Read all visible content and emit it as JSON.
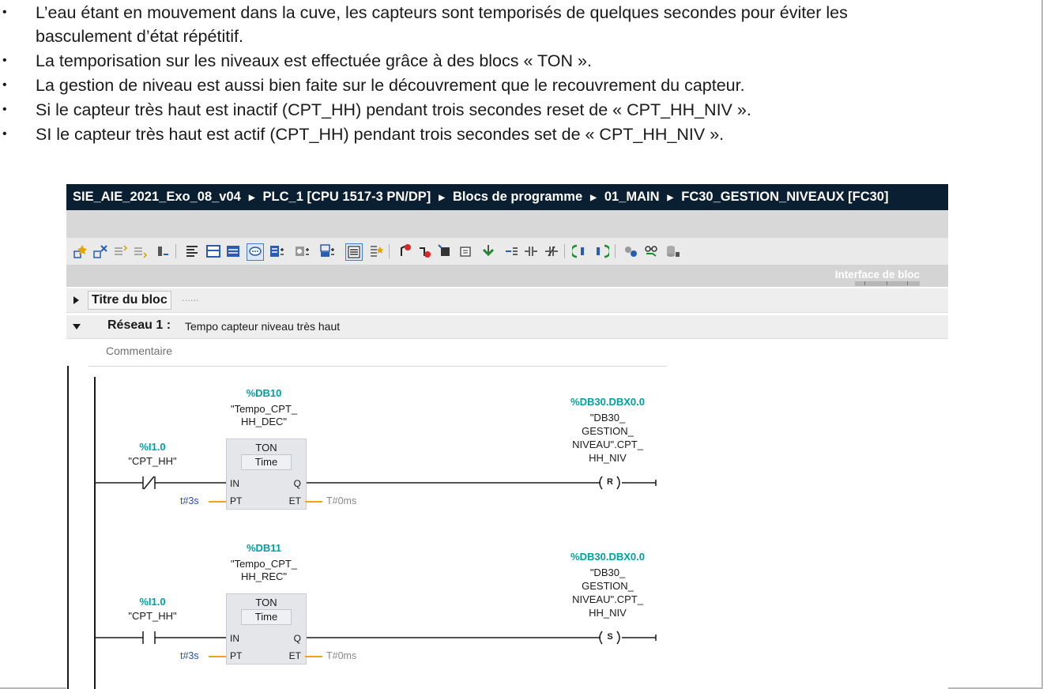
{
  "bullets": [
    "L’eau étant en mouvement dans la cuve, les capteurs sont temporisés de quelques secondes pour éviter les",
    "basculement d’état répétitif.",
    "La temporisation sur les niveaux est effectuée grâce à des blocs « TON ».",
    "La gestion de niveau est aussi bien faite sur le découvrement que le recouvrement du capteur.",
    "Si le capteur très haut est inactif (CPT_HH) pendant trois secondes reset de « CPT_HH_NIV ».",
    "SI le capteur très haut est actif (CPT_HH) pendant trois secondes set de « CPT_HH_NIV »."
  ],
  "bullet_symbol": "•",
  "breadcrumb": {
    "project": "SIE_AIE_2021_Exo_08_v04",
    "plc": "PLC_1 [CPU 1517-3 PN/DP]",
    "folder": "Blocs de programme",
    "subfolder": "01_MAIN",
    "block": "FC30_GESTION_NIVEAUX [FC30]"
  },
  "interface_label": "Interface de bloc",
  "block_title": "Titre du bloc",
  "block_title_dots": "......",
  "network": {
    "label": "Réseau 1 :",
    "description": "Tempo capteur niveau très haut",
    "comment": "Commentaire"
  },
  "rungs": [
    {
      "contact_addr": "%I1.0",
      "contact_name": "\"CPT_HH\"",
      "contact_type": "normally-closed",
      "db_addr": "%DB10",
      "db_name": [
        "\"Tempo_CPT_",
        "HH_DEC\""
      ],
      "timer_type": "TON",
      "timer_unit": "Time",
      "pin_in": "IN",
      "pin_q": "Q",
      "pin_pt": "PT",
      "pin_et": "ET",
      "pt_value": "t#3s",
      "et_value": "T#0ms",
      "coil_addr": "%DB30.DBX0.0",
      "coil_name": [
        "\"DB30_",
        "GESTION_",
        "NIVEAU\".CPT_",
        "HH_NIV"
      ],
      "coil_type": "R"
    },
    {
      "contact_addr": "%I1.0",
      "contact_name": "\"CPT_HH\"",
      "contact_type": "normally-open",
      "db_addr": "%DB11",
      "db_name": [
        "\"Tempo_CPT_",
        "HH_REC\""
      ],
      "timer_type": "TON",
      "timer_unit": "Time",
      "pin_in": "IN",
      "pin_q": "Q",
      "pin_pt": "PT",
      "pin_et": "ET",
      "pt_value": "t#3s",
      "et_value": "T#0ms",
      "coil_addr": "%DB30.DBX0.0",
      "coil_name": [
        "\"DB30_",
        "GESTION_",
        "NIVEAU\".CPT_",
        "HH_NIV"
      ],
      "coil_type": "S"
    }
  ],
  "colors": {
    "breadcrumb_bg": "#0b1f33",
    "address": "#00a0a0",
    "pt_value": "#2b4fb4",
    "connector": "#f0a21c"
  }
}
